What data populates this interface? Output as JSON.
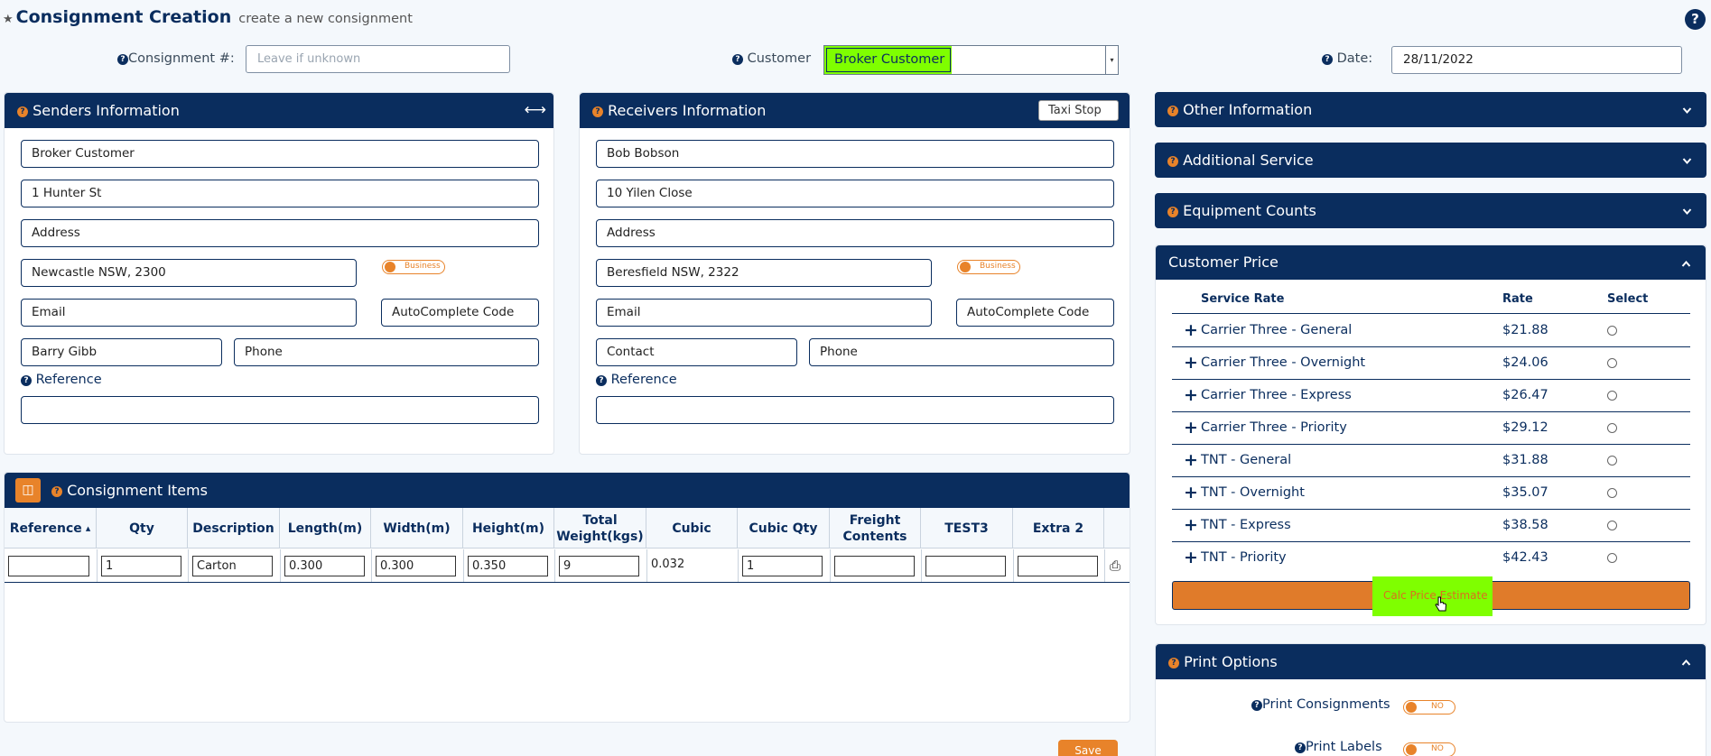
{
  "page": {
    "title": "Consignment Creation",
    "subtitle": "create a new consignment"
  },
  "top": {
    "consignment_label": "Consignment #:",
    "consignment_placeholder": "Leave if unknown",
    "customer_label": "Customer",
    "customer_value": "Broker Customer",
    "date_label": "Date:",
    "date_value": "28/11/2022"
  },
  "senders": {
    "title": "Senders Information",
    "name": "Broker Customer",
    "street": "1 Hunter St",
    "address": "Address",
    "suburb": "Newcastle NSW, 2300",
    "business_toggle": "Business",
    "email": "Email",
    "autocomplete": "AutoComplete Code",
    "contact": "Barry Gibb",
    "phone": "Phone",
    "reference_label": "Reference",
    "reference_value": ""
  },
  "receivers": {
    "title": "Receivers Information",
    "taxi_stop": "Taxi Stop",
    "name": "Bob Bobson",
    "street": "10 Yilen Close",
    "address": "Address",
    "suburb": "Beresfield NSW, 2322",
    "business_toggle": "Business",
    "email": "Email",
    "autocomplete": "AutoComplete Code",
    "contact": "Contact",
    "phone": "Phone",
    "reference_label": "Reference",
    "reference_value": ""
  },
  "items": {
    "title": "Consignment Items",
    "columns": [
      "Reference",
      "Qty",
      "Description",
      "Length(m)",
      "Width(m)",
      "Height(m)",
      "Total Weight(kgs)",
      "Cubic",
      "Cubic Qty",
      "Freight Contents",
      "TEST3",
      "Extra 2"
    ],
    "row": {
      "reference": "",
      "qty": "1",
      "description": "Carton",
      "length": "0.300",
      "width": "0.300",
      "height": "0.350",
      "weight": "9",
      "cubic": "0.032",
      "cubic_qty": "1",
      "freight": "",
      "test3": "",
      "extra2": ""
    },
    "save_label": "Save"
  },
  "right": {
    "other_info": "Other Information",
    "additional_service": "Additional Service",
    "equipment_counts": "Equipment Counts",
    "customer_price": "Customer Price",
    "rate_headers": {
      "service": "Service Rate",
      "rate": "Rate",
      "select": "Select"
    },
    "rates": [
      {
        "service": "Carrier Three - General",
        "rate": "$21.88"
      },
      {
        "service": "Carrier Three - Overnight",
        "rate": "$24.06"
      },
      {
        "service": "Carrier Three - Express",
        "rate": "$26.47"
      },
      {
        "service": "Carrier Three - Priority",
        "rate": "$29.12"
      },
      {
        "service": "TNT - General",
        "rate": "$31.88"
      },
      {
        "service": "TNT - Overnight",
        "rate": "$35.07"
      },
      {
        "service": "TNT - Express",
        "rate": "$38.58"
      },
      {
        "service": "TNT - Priority",
        "rate": "$42.43"
      }
    ],
    "calc_label": "Calc Price Estimate",
    "print_options": "Print Options",
    "print_consignments_label": "Print Consignments",
    "print_consignments_value": "NO",
    "print_labels_label": "Print Labels",
    "print_labels_value": "NO"
  },
  "colors": {
    "navy": "#0a2d5e",
    "orange": "#e8832a",
    "highlight": "#7fff00"
  },
  "icons": [
    "star-icon",
    "help-icon",
    "resize-arrows-icon",
    "chevron-down-icon",
    "chevron-up-icon",
    "plus-icon",
    "printer-icon",
    "panel-toggle-icon",
    "cursor-hand-icon"
  ]
}
